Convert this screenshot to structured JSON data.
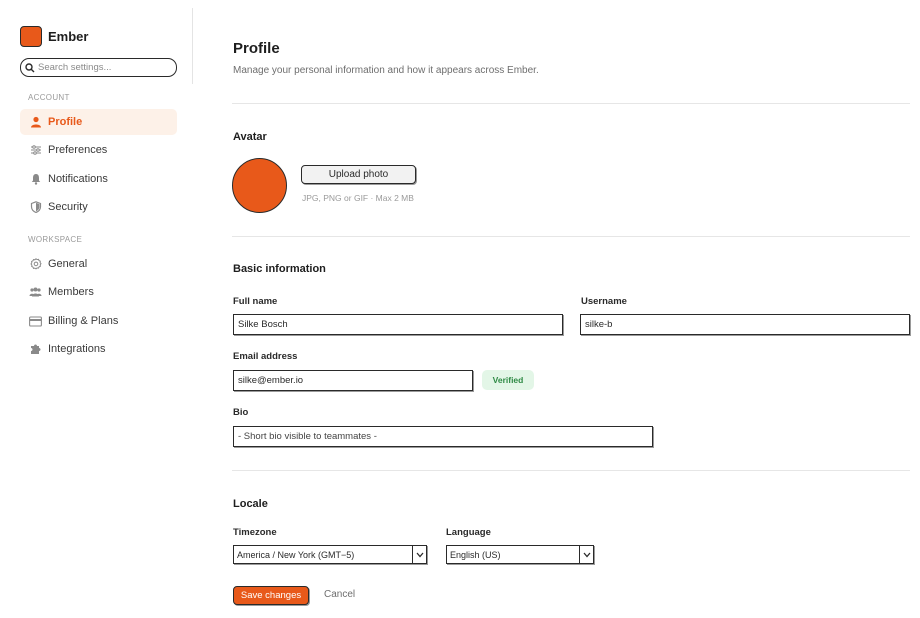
{
  "brand": {
    "name": "Ember",
    "color": "#e8591a"
  },
  "search": {
    "placeholder": "Search settings..."
  },
  "sidebar": {
    "account_label": "ACCOUNT",
    "workspace_label": "WORKSPACE",
    "account_items": [
      {
        "label": "Profile",
        "icon": "user-icon",
        "active": true
      },
      {
        "label": "Preferences",
        "icon": "sliders-icon"
      },
      {
        "label": "Notifications",
        "icon": "bell-icon"
      },
      {
        "label": "Security",
        "icon": "shield-icon"
      }
    ],
    "workspace_items": [
      {
        "label": "General",
        "icon": "gear-icon"
      },
      {
        "label": "Members",
        "icon": "users-icon"
      },
      {
        "label": "Billing & Plans",
        "icon": "credit-card-icon"
      },
      {
        "label": "Integrations",
        "icon": "puzzle-icon"
      }
    ]
  },
  "main": {
    "title": "Profile",
    "subtitle": "Manage your personal information and how it appears across Ember.",
    "avatar": {
      "title": "Avatar",
      "upload_label": "Upload photo",
      "hint": "JPG, PNG or GIF · Max 2 MB"
    },
    "basic": {
      "title": "Basic information",
      "full_name_label": "Full name",
      "full_name_value": "Silke Bosch",
      "username_label": "Username",
      "username_value": "silke-b",
      "email_label": "Email address",
      "email_value": "silke@ember.io",
      "verified_label": "Verified",
      "bio_label": "Bio",
      "bio_placeholder": "- Short bio visible to teammates -"
    },
    "locale": {
      "title": "Locale",
      "timezone_label": "Timezone",
      "timezone_value": "America / New York (GMT−5)",
      "language_label": "Language",
      "language_value": "English (US)"
    },
    "actions": {
      "save_label": "Save changes",
      "cancel_label": "Cancel"
    }
  },
  "colors": {
    "accent": "#e8591a",
    "active_bg": "#fdf1e8",
    "verified_bg": "#e3f6e7",
    "verified_text": "#2f8a45"
  }
}
